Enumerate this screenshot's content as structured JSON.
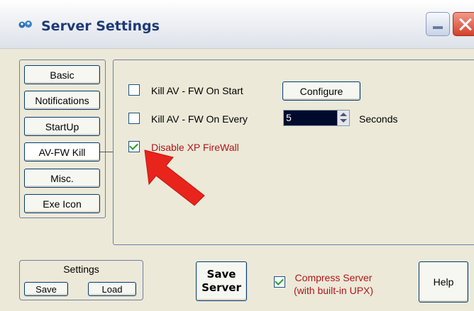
{
  "window": {
    "title": "Server Settings"
  },
  "nav": {
    "items": [
      {
        "label": "Basic"
      },
      {
        "label": "Notifications"
      },
      {
        "label": "StartUp"
      },
      {
        "label": "AV-FW Kill"
      },
      {
        "label": "Misc."
      },
      {
        "label": "Exe Icon"
      }
    ],
    "selected": "AV-FW Kill"
  },
  "avfw": {
    "kill_on_start": {
      "label": "Kill AV - FW On Start",
      "checked": false
    },
    "configure_label": "Configure",
    "kill_on_every": {
      "label": "Kill AV - FW On Every",
      "checked": false,
      "interval_value": "5",
      "unit_label": "Seconds"
    },
    "disable_firewall": {
      "label": "Disable XP FireWall",
      "checked": true
    }
  },
  "settings": {
    "title": "Settings",
    "save_label": "Save",
    "load_label": "Load"
  },
  "save_server": {
    "line1": "Save",
    "line2": "Server"
  },
  "compress": {
    "line1": "Compress Server",
    "line2": "(with built-in UPX)",
    "checked": true
  },
  "help_label": "Help",
  "colors": {
    "title_text": "#1e3a78",
    "warning_text": "#b0151a",
    "arrow": "#e8241c",
    "check": "#21a121",
    "spin_bg": "#000a2c"
  },
  "icons": [
    "app-icon",
    "minimize-icon",
    "close-icon",
    "pointer-arrow-icon",
    "spin-up-icon",
    "spin-down-icon"
  ]
}
